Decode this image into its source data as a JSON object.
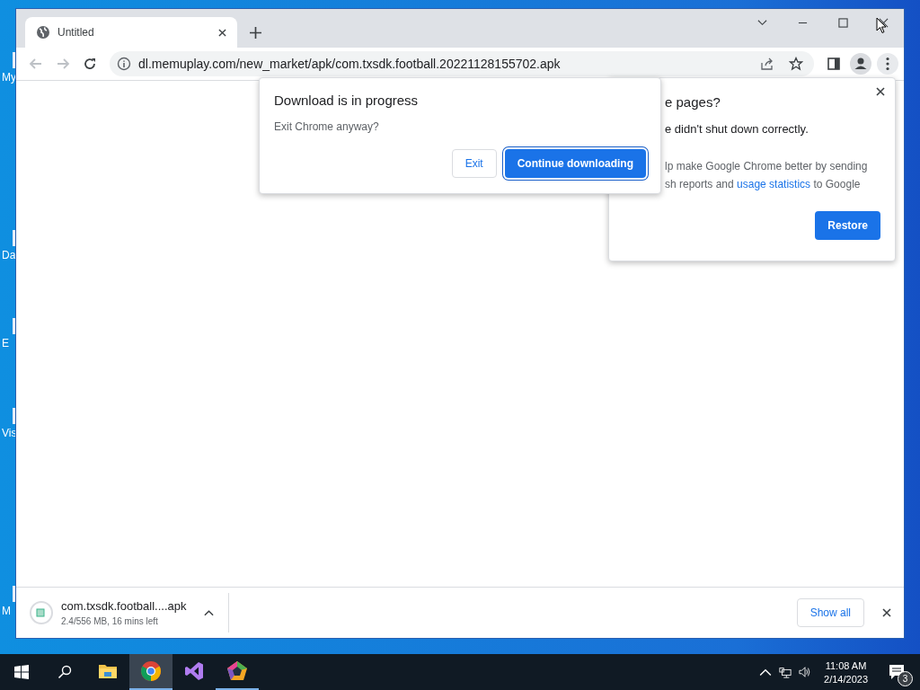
{
  "desktop_icons": [
    {
      "label": "My"
    },
    {
      "label": "Da"
    },
    {
      "label": "E"
    },
    {
      "label": "Vis"
    },
    {
      "label": "M"
    }
  ],
  "browser": {
    "tabs": [
      {
        "title": "Untitled",
        "selected": true
      }
    ],
    "address": "dl.memuplay.com/new_market/apk/com.txsdk.football.20221128155702.apk"
  },
  "download_dialog": {
    "title": "Download is in progress",
    "message": "Exit Chrome anyway?",
    "buttons": [
      {
        "label": "Exit",
        "kind": "secondary"
      },
      {
        "label": "Continue downloading",
        "kind": "primary"
      }
    ]
  },
  "restore_bubble": {
    "title": "e pages?",
    "message": "e didn't shut down correctly.",
    "consent_before": "lp make Google Chrome better by sending",
    "consent_mid": "sh reports and ",
    "consent_link": "usage statistics",
    "consent_after": " to Google",
    "button": "Restore"
  },
  "download_shelf": {
    "file": "com.txsdk.football....apk",
    "status": "2.4/556 MB, 16 mins left",
    "button": "Show all"
  },
  "taskbar": {
    "apps": [
      {
        "kind": "explorer",
        "selected": false,
        "running": false
      },
      {
        "kind": "chrome",
        "selected": true,
        "running": true
      },
      {
        "kind": "studio",
        "selected": false,
        "running": false
      },
      {
        "kind": "pentagon",
        "selected": false,
        "running": true
      }
    ],
    "time": "11:08 AM",
    "date": "2/14/2023",
    "notifications": "3"
  }
}
